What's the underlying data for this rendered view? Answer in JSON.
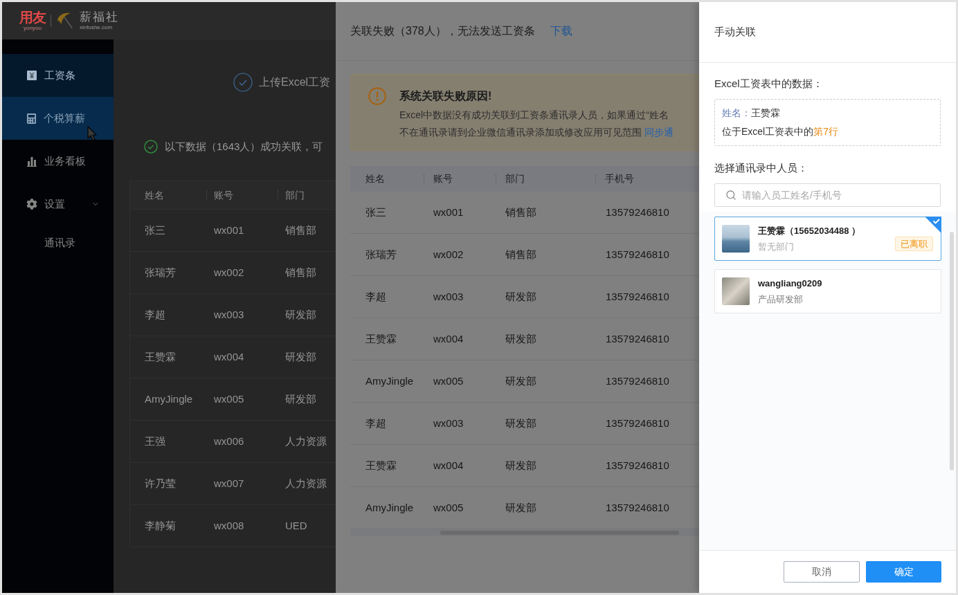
{
  "logo": {
    "primary": "用友",
    "primary_sub": "yonyou",
    "secondary": "薪福社",
    "secondary_sub": "xinfushe.com"
  },
  "sidebar": {
    "items": [
      {
        "label": "工资条",
        "selected": true,
        "hovered": false
      },
      {
        "label": "个税算薪",
        "selected": false,
        "hovered": true
      },
      {
        "label": "业务看板",
        "selected": false,
        "hovered": false
      },
      {
        "label": "设置",
        "selected": false,
        "hovered": false,
        "expanded": true,
        "children": [
          {
            "label": "通讯录",
            "selected": false,
            "hovered": false
          }
        ]
      }
    ]
  },
  "main": {
    "upload_step": "上传Excel工资",
    "success_note": "以下数据（1643人）成功关联，可",
    "table": {
      "columns": [
        "姓名",
        "账号",
        "部门"
      ],
      "rows": [
        [
          "张三",
          "wx001",
          "销售部"
        ],
        [
          "张瑞芳",
          "wx002",
          "销售部"
        ],
        [
          "李超",
          "wx003",
          "研发部"
        ],
        [
          "王赞霖",
          "wx004",
          "研发部"
        ],
        [
          "AmyJingle",
          "wx005",
          "研发部"
        ],
        [
          "王强",
          "wx006",
          "人力资源"
        ],
        [
          "许乃莹",
          "wx007",
          "人力资源"
        ],
        [
          "李静菊",
          "wx008",
          "UED"
        ]
      ]
    }
  },
  "failed_panel": {
    "title": "关联失败（378人），无法发送工资条",
    "download_link": "下载",
    "notice": {
      "title": "系统关联失败原因!",
      "lines": [
        "Excel中数据没有成功关联到工资条通讯录人员，如果通过“姓名",
        "不在通讯录请到企业微信通讯录添加或修改应用可见范围"
      ],
      "link": "同步通"
    },
    "table": {
      "columns": [
        "姓名",
        "账号",
        "部门",
        "手机号"
      ],
      "rows": [
        [
          "张三",
          "wx001",
          "销售部",
          "13579246810"
        ],
        [
          "张瑞芳",
          "wx002",
          "销售部",
          "13579246810"
        ],
        [
          "李超",
          "wx003",
          "研发部",
          "13579246810"
        ],
        [
          "王赞霖",
          "wx004",
          "研发部",
          "13579246810"
        ],
        [
          "AmyJingle",
          "wx005",
          "研发部",
          "13579246810"
        ],
        [
          "李超",
          "wx003",
          "研发部",
          "13579246810"
        ],
        [
          "王赞霖",
          "wx004",
          "研发部",
          "13579246810"
        ],
        [
          "AmyJingle",
          "wx005",
          "研发部",
          "13579246810"
        ]
      ]
    }
  },
  "manual_panel": {
    "title": "手动关联",
    "source_label": "Excel工资表中的数据：",
    "source": {
      "field_label": "姓名：",
      "field_value": "王赞霖",
      "position_prefix": "位于Excel工资表中的",
      "position_highlight": "第7行"
    },
    "pick_label": "选择通讯录中人员：",
    "search": {
      "placeholder": "请输入员工姓名/手机号"
    },
    "candidates": [
      {
        "name": "王赞霖（15652034488 ）",
        "department": "暂无部门",
        "tag": "已离职",
        "selected": true
      },
      {
        "name": "wangliang0209",
        "department": "产品研发部",
        "selected": false
      }
    ],
    "buttons": [
      {
        "label": "取消",
        "kind": "secondary"
      },
      {
        "label": "确定",
        "kind": "primary"
      }
    ]
  }
}
